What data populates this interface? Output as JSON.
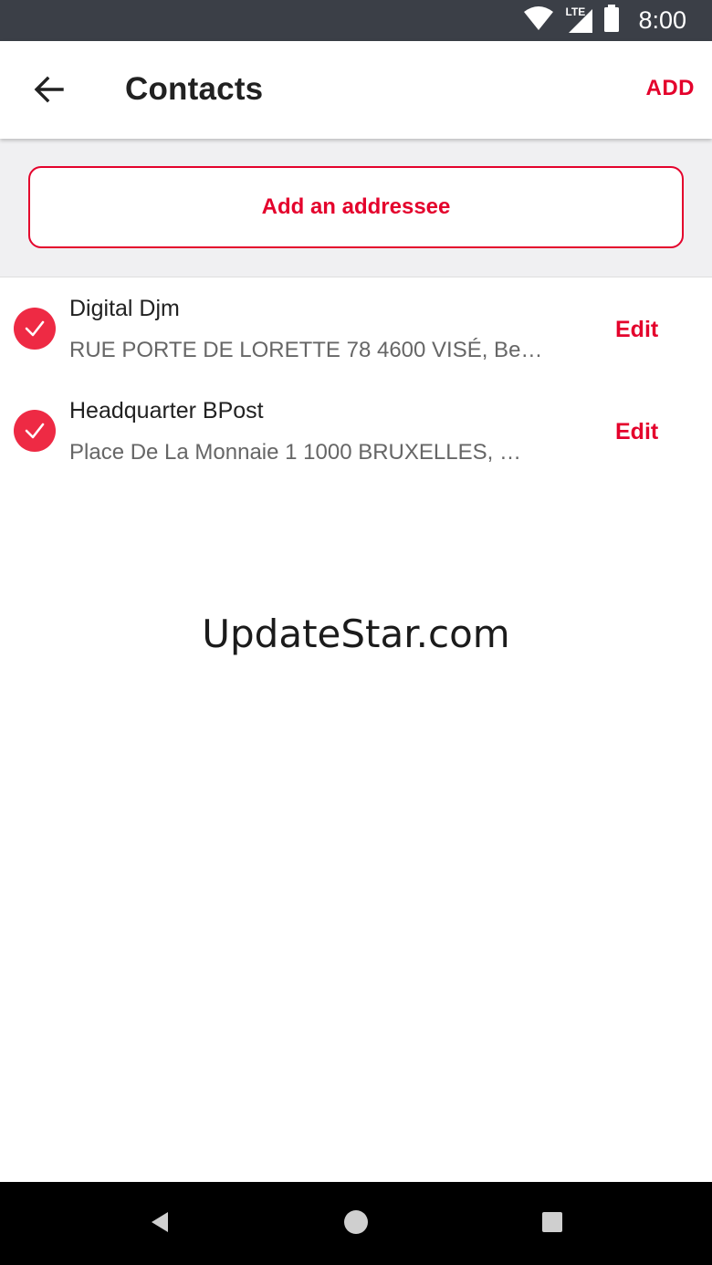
{
  "status_bar": {
    "time": "8:00",
    "network_label": "LTE",
    "icons": [
      "wifi-icon",
      "cellular-signal-icon",
      "battery-icon"
    ]
  },
  "app_bar": {
    "title": "Contacts",
    "back_icon": "arrow-left-icon",
    "action_label": "ADD"
  },
  "add_panel": {
    "button_label": "Add an addressee"
  },
  "contacts": [
    {
      "name": "Digital Djm",
      "address": "RUE PORTE DE LORETTE 78 4600 VISÉ, Be…",
      "selected": true,
      "edit_label": "Edit"
    },
    {
      "name": "Headquarter BPost",
      "address": "Place De La Monnaie 1 1000 BRUXELLES, …",
      "selected": true,
      "edit_label": "Edit"
    }
  ],
  "watermark": "UpdateStar.com",
  "nav_bar": {
    "icons": [
      "back-triangle-icon",
      "home-circle-icon",
      "recents-square-icon"
    ]
  },
  "colors": {
    "accent": "#e4022c",
    "check": "#ee2a44",
    "status_bar": "#3b3f47",
    "panel_bg": "#f0f0f2",
    "nav_bar": "#000000"
  }
}
